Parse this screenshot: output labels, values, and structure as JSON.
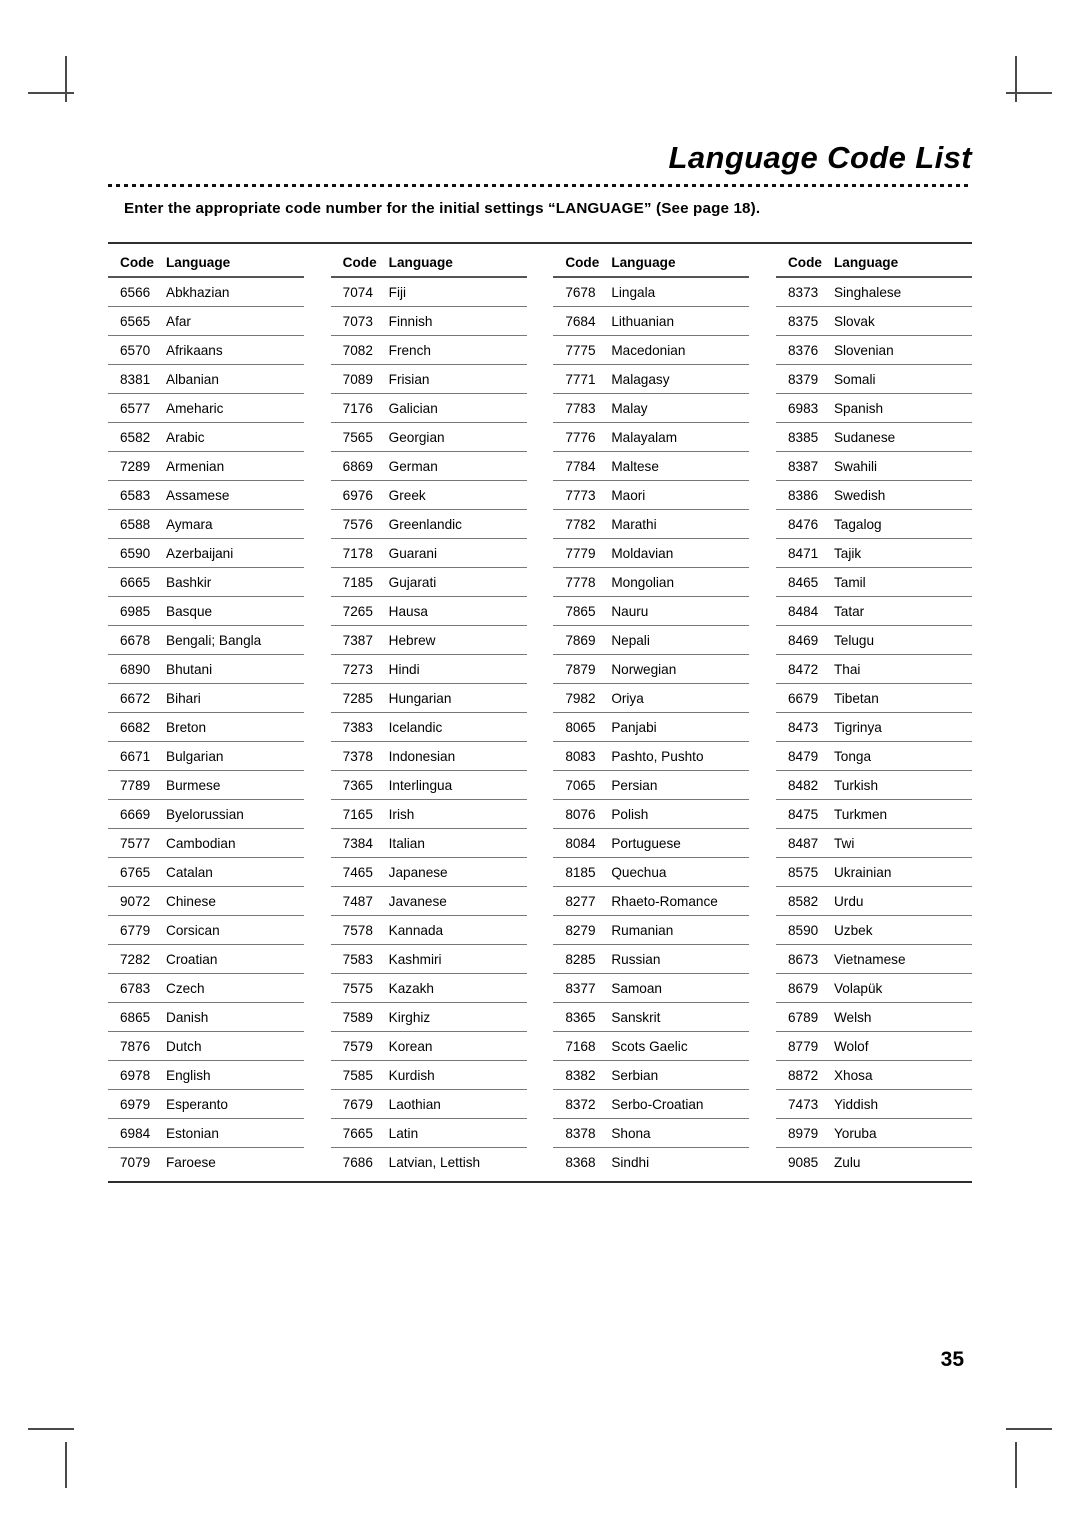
{
  "document": {
    "title": "Language Code List",
    "subtitle": "Enter the appropriate code number for the initial settings “LANGUAGE” (See page 18).",
    "page_number": "35"
  },
  "table": {
    "headers": {
      "code": "Code",
      "language": "Language"
    },
    "columns": [
      {
        "rows": [
          {
            "code": "6566",
            "language": "Abkhazian"
          },
          {
            "code": "6565",
            "language": "Afar"
          },
          {
            "code": "6570",
            "language": "Afrikaans"
          },
          {
            "code": "8381",
            "language": "Albanian"
          },
          {
            "code": "6577",
            "language": "Ameharic"
          },
          {
            "code": "6582",
            "language": "Arabic"
          },
          {
            "code": "7289",
            "language": "Armenian"
          },
          {
            "code": "6583",
            "language": "Assamese"
          },
          {
            "code": "6588",
            "language": "Aymara"
          },
          {
            "code": "6590",
            "language": "Azerbaijani"
          },
          {
            "code": "6665",
            "language": "Bashkir"
          },
          {
            "code": "6985",
            "language": "Basque"
          },
          {
            "code": "6678",
            "language": "Bengali; Bangla"
          },
          {
            "code": "6890",
            "language": "Bhutani"
          },
          {
            "code": "6672",
            "language": "Bihari"
          },
          {
            "code": "6682",
            "language": "Breton"
          },
          {
            "code": "6671",
            "language": "Bulgarian"
          },
          {
            "code": "7789",
            "language": "Burmese"
          },
          {
            "code": "6669",
            "language": "Byelorussian"
          },
          {
            "code": "7577",
            "language": "Cambodian"
          },
          {
            "code": "6765",
            "language": "Catalan"
          },
          {
            "code": "9072",
            "language": "Chinese"
          },
          {
            "code": "6779",
            "language": "Corsican"
          },
          {
            "code": "7282",
            "language": "Croatian"
          },
          {
            "code": "6783",
            "language": "Czech"
          },
          {
            "code": "6865",
            "language": "Danish"
          },
          {
            "code": "7876",
            "language": "Dutch"
          },
          {
            "code": "6978",
            "language": "English"
          },
          {
            "code": "6979",
            "language": "Esperanto"
          },
          {
            "code": "6984",
            "language": "Estonian"
          },
          {
            "code": "7079",
            "language": "Faroese"
          }
        ]
      },
      {
        "rows": [
          {
            "code": "7074",
            "language": "Fiji"
          },
          {
            "code": "7073",
            "language": "Finnish"
          },
          {
            "code": "7082",
            "language": "French"
          },
          {
            "code": "7089",
            "language": "Frisian"
          },
          {
            "code": "7176",
            "language": "Galician"
          },
          {
            "code": "7565",
            "language": "Georgian"
          },
          {
            "code": "6869",
            "language": "German"
          },
          {
            "code": "6976",
            "language": "Greek"
          },
          {
            "code": "7576",
            "language": "Greenlandic"
          },
          {
            "code": "7178",
            "language": "Guarani"
          },
          {
            "code": "7185",
            "language": "Gujarati"
          },
          {
            "code": "7265",
            "language": "Hausa"
          },
          {
            "code": "7387",
            "language": "Hebrew"
          },
          {
            "code": "7273",
            "language": "Hindi"
          },
          {
            "code": "7285",
            "language": "Hungarian"
          },
          {
            "code": "7383",
            "language": "Icelandic"
          },
          {
            "code": "7378",
            "language": "Indonesian"
          },
          {
            "code": "7365",
            "language": "Interlingua"
          },
          {
            "code": "7165",
            "language": "Irish"
          },
          {
            "code": "7384",
            "language": "Italian"
          },
          {
            "code": "7465",
            "language": "Japanese"
          },
          {
            "code": "7487",
            "language": "Javanese"
          },
          {
            "code": "7578",
            "language": "Kannada"
          },
          {
            "code": "7583",
            "language": "Kashmiri"
          },
          {
            "code": "7575",
            "language": "Kazakh"
          },
          {
            "code": "7589",
            "language": "Kirghiz"
          },
          {
            "code": "7579",
            "language": "Korean"
          },
          {
            "code": "7585",
            "language": "Kurdish"
          },
          {
            "code": "7679",
            "language": "Laothian"
          },
          {
            "code": "7665",
            "language": "Latin"
          },
          {
            "code": "7686",
            "language": "Latvian, Lettish"
          }
        ]
      },
      {
        "rows": [
          {
            "code": "7678",
            "language": "Lingala"
          },
          {
            "code": "7684",
            "language": "Lithuanian"
          },
          {
            "code": "7775",
            "language": "Macedonian"
          },
          {
            "code": "7771",
            "language": "Malagasy"
          },
          {
            "code": "7783",
            "language": "Malay"
          },
          {
            "code": "7776",
            "language": "Malayalam"
          },
          {
            "code": "7784",
            "language": "Maltese"
          },
          {
            "code": "7773",
            "language": "Maori"
          },
          {
            "code": "7782",
            "language": "Marathi"
          },
          {
            "code": "7779",
            "language": "Moldavian"
          },
          {
            "code": "7778",
            "language": "Mongolian"
          },
          {
            "code": "7865",
            "language": "Nauru"
          },
          {
            "code": "7869",
            "language": "Nepali"
          },
          {
            "code": "7879",
            "language": "Norwegian"
          },
          {
            "code": "7982",
            "language": "Oriya"
          },
          {
            "code": "8065",
            "language": "Panjabi"
          },
          {
            "code": "8083",
            "language": "Pashto, Pushto"
          },
          {
            "code": "7065",
            "language": "Persian"
          },
          {
            "code": "8076",
            "language": "Polish"
          },
          {
            "code": "8084",
            "language": "Portuguese"
          },
          {
            "code": "8185",
            "language": "Quechua"
          },
          {
            "code": "8277",
            "language": "Rhaeto-Romance"
          },
          {
            "code": "8279",
            "language": "Rumanian"
          },
          {
            "code": "8285",
            "language": "Russian"
          },
          {
            "code": "8377",
            "language": "Samoan"
          },
          {
            "code": "8365",
            "language": "Sanskrit"
          },
          {
            "code": "7168",
            "language": "Scots Gaelic"
          },
          {
            "code": "8382",
            "language": "Serbian"
          },
          {
            "code": "8372",
            "language": "Serbo-Croatian"
          },
          {
            "code": "8378",
            "language": "Shona"
          },
          {
            "code": "8368",
            "language": "Sindhi"
          }
        ]
      },
      {
        "rows": [
          {
            "code": "8373",
            "language": "Singhalese"
          },
          {
            "code": "8375",
            "language": "Slovak"
          },
          {
            "code": "8376",
            "language": "Slovenian"
          },
          {
            "code": "8379",
            "language": "Somali"
          },
          {
            "code": "6983",
            "language": "Spanish"
          },
          {
            "code": "8385",
            "language": "Sudanese"
          },
          {
            "code": "8387",
            "language": "Swahili"
          },
          {
            "code": "8386",
            "language": "Swedish"
          },
          {
            "code": "8476",
            "language": "Tagalog"
          },
          {
            "code": "8471",
            "language": "Tajik"
          },
          {
            "code": "8465",
            "language": "Tamil"
          },
          {
            "code": "8484",
            "language": "Tatar"
          },
          {
            "code": "8469",
            "language": "Telugu"
          },
          {
            "code": "8472",
            "language": "Thai"
          },
          {
            "code": "6679",
            "language": "Tibetan"
          },
          {
            "code": "8473",
            "language": "Tigrinya"
          },
          {
            "code": "8479",
            "language": "Tonga"
          },
          {
            "code": "8482",
            "language": "Turkish"
          },
          {
            "code": "8475",
            "language": "Turkmen"
          },
          {
            "code": "8487",
            "language": "Twi"
          },
          {
            "code": "8575",
            "language": "Ukrainian"
          },
          {
            "code": "8582",
            "language": "Urdu"
          },
          {
            "code": "8590",
            "language": "Uzbek"
          },
          {
            "code": "8673",
            "language": "Vietnamese"
          },
          {
            "code": "8679",
            "language": "Volapük"
          },
          {
            "code": "6789",
            "language": "Welsh"
          },
          {
            "code": "8779",
            "language": "Wolof"
          },
          {
            "code": "8872",
            "language": "Xhosa"
          },
          {
            "code": "7473",
            "language": "Yiddish"
          },
          {
            "code": "8979",
            "language": "Yoruba"
          },
          {
            "code": "9085",
            "language": "Zulu"
          }
        ]
      }
    ]
  }
}
